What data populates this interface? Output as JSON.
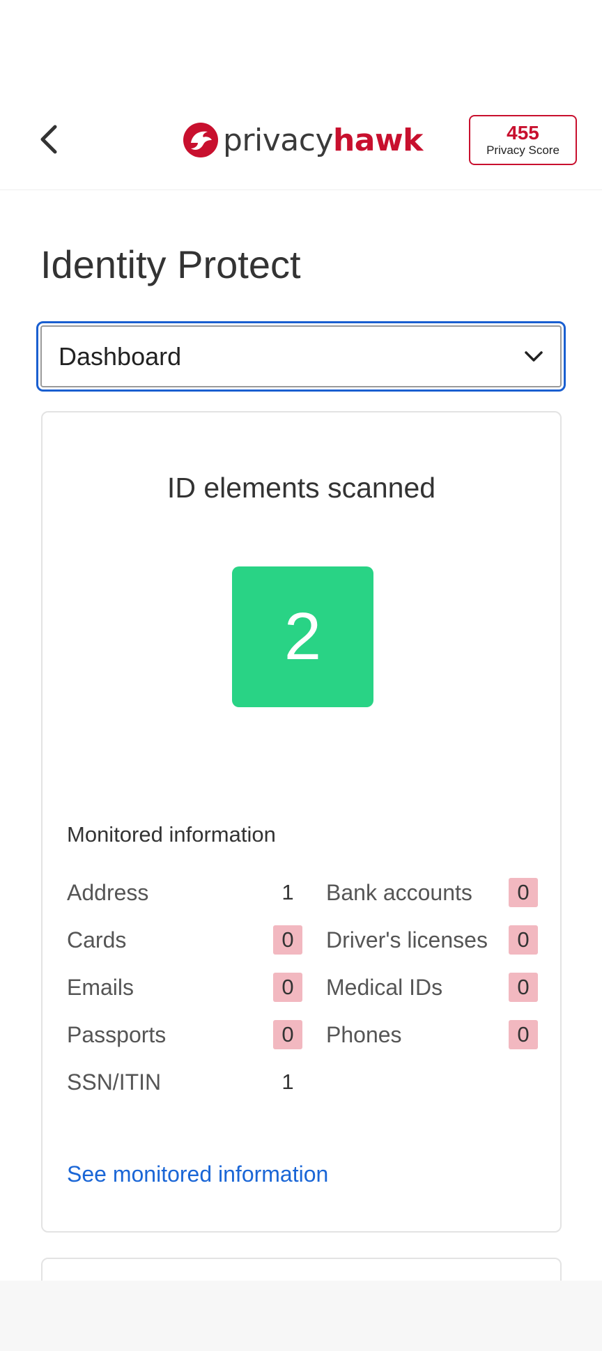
{
  "header": {
    "back_icon": "chevron-left-icon",
    "logo": {
      "icon": "hawk-logo-icon",
      "text_part1": "privacy",
      "text_part2": "hawk"
    },
    "privacy_score": {
      "value": "455",
      "label": "Privacy Score"
    }
  },
  "main": {
    "title": "Identity Protect",
    "select": {
      "value": "Dashboard",
      "icon": "chevron-down-icon"
    },
    "card": {
      "title": "ID elements scanned",
      "count": "2",
      "monitored_title": "Monitored information",
      "rows": [
        {
          "left_label": "Address",
          "left_value": "1",
          "right_label": "Bank accounts",
          "right_value": "0"
        },
        {
          "left_label": "Cards",
          "left_value": "0",
          "right_label": "Driver's licenses",
          "right_value": "0"
        },
        {
          "left_label": "Emails",
          "left_value": "0",
          "right_label": "Medical IDs",
          "right_value": "0"
        },
        {
          "left_label": "Passports",
          "left_value": "0",
          "right_label": "Phones",
          "right_value": "0"
        },
        {
          "left_label": "SSN/ITIN",
          "left_value": "1"
        }
      ],
      "link": "See monitored information"
    }
  },
  "colors": {
    "brand_red": "#c8102e",
    "accent_green": "#29d385",
    "link_blue": "#1a66d6",
    "focus_blue": "#1a5fd0",
    "zero_badge": "#f2b8c0"
  }
}
